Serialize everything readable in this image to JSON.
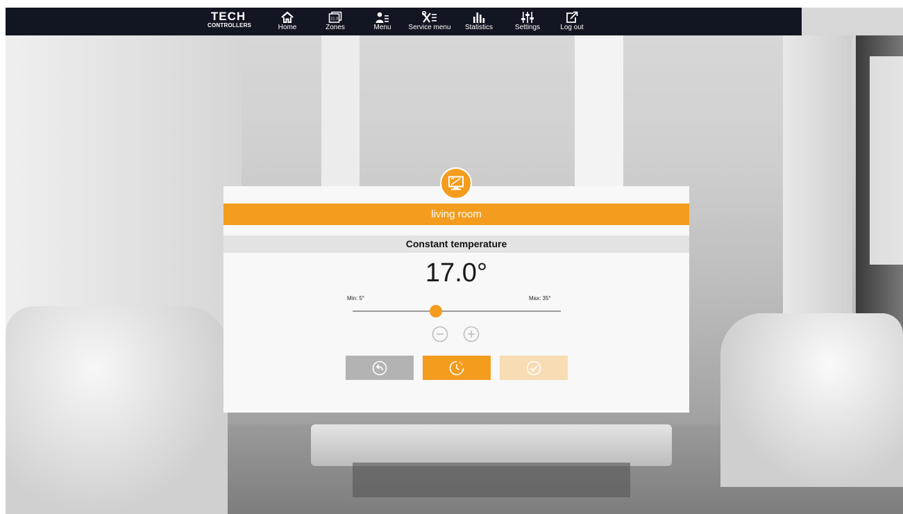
{
  "brand": {
    "logo": "TECH",
    "subtitle": "CONTROLLERS"
  },
  "nav": {
    "items": [
      {
        "label": "Home",
        "icon": "home-icon"
      },
      {
        "label": "Zones",
        "icon": "zones-icon",
        "icon_text": "21.0"
      },
      {
        "label": "Menu",
        "icon": "menu-icon"
      },
      {
        "label": "Service menu",
        "icon": "service-menu-icon"
      },
      {
        "label": "Statistics",
        "icon": "statistics-icon"
      },
      {
        "label": "Settings",
        "icon": "settings-icon"
      },
      {
        "label": "Log out",
        "icon": "logout-icon"
      }
    ]
  },
  "dialog": {
    "zone_name": "living room",
    "zone_icon": "monitor-icon",
    "mode_label": "Constant temperature",
    "temperature_display": "17.0°",
    "slider": {
      "min_label": "Min: 5°",
      "max_label": "Max: 35°",
      "min": 5,
      "max": 35,
      "value": 17
    },
    "buttons": {
      "back": "back-icon",
      "timer": "timer-icon",
      "confirm": "confirm-icon"
    }
  },
  "colors": {
    "accent": "#f39c1d",
    "nav_bg": "#121522",
    "mode_bar": "#e3e3e3",
    "back_button": "#b3b3b3",
    "confirm_disabled": "#f8dcb3"
  }
}
